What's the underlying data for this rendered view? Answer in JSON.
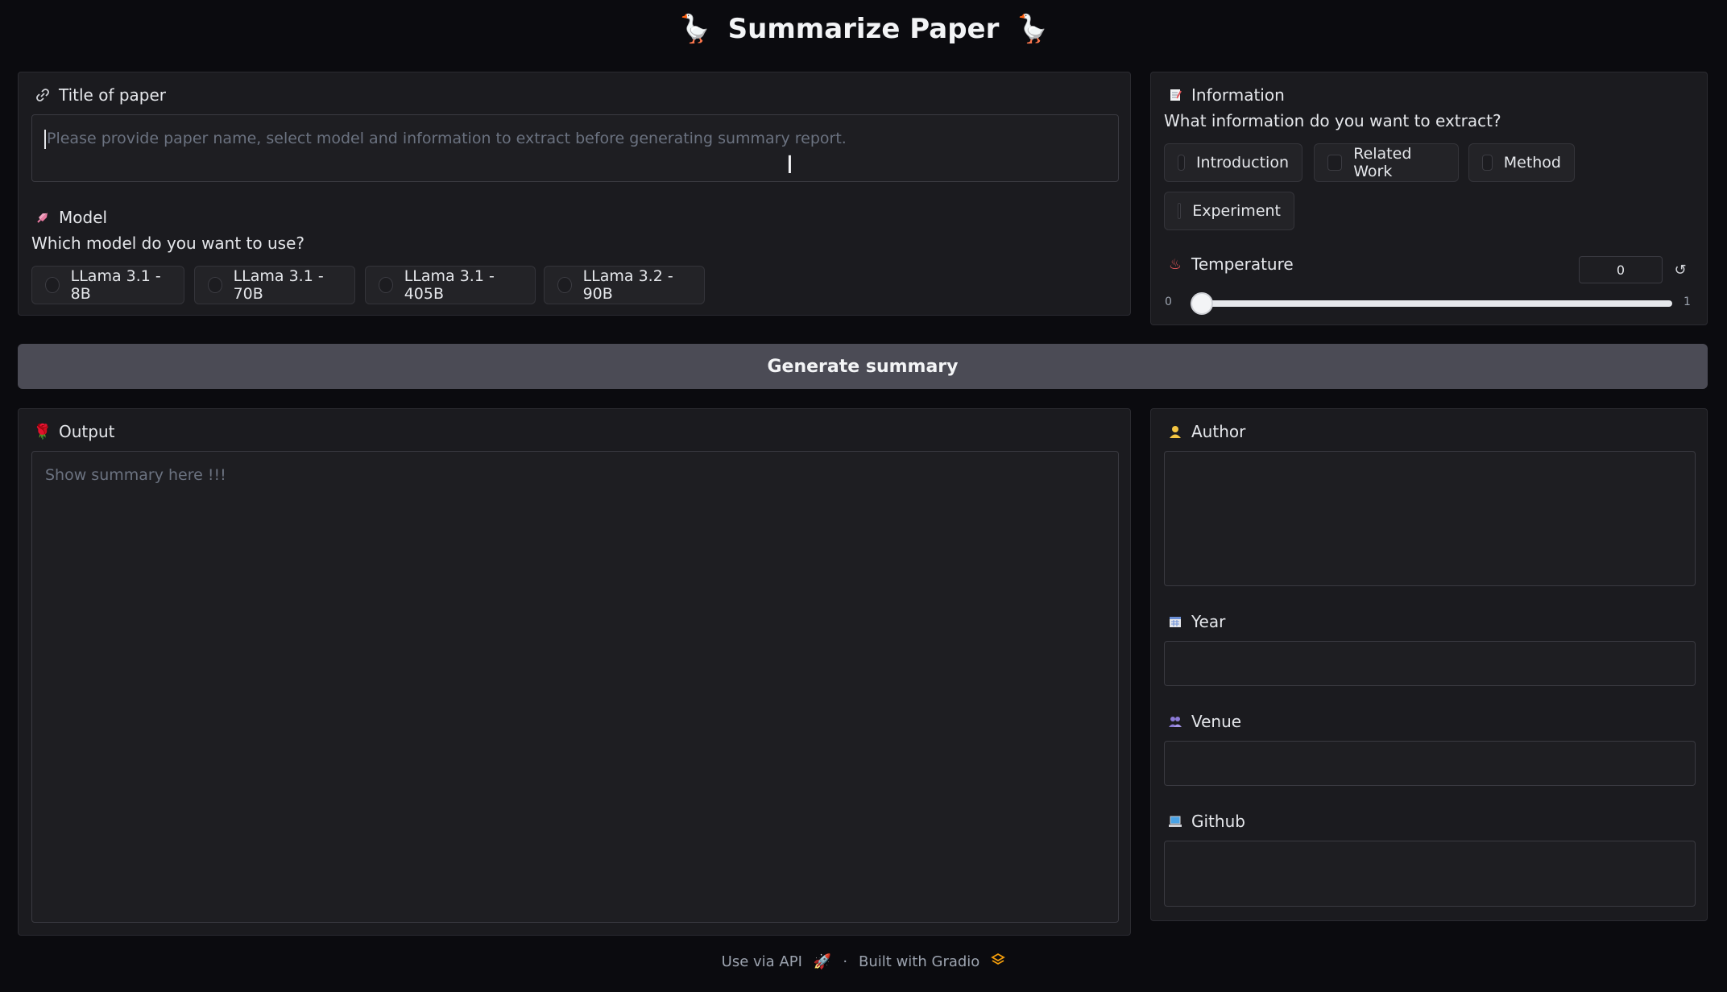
{
  "header": {
    "title": "Summarize Paper",
    "left_icon": "🪿",
    "right_icon": "🪿"
  },
  "paper": {
    "label": "Title of paper",
    "label_icon": "link-icon",
    "placeholder": "Please provide paper name, select model and information to extract before generating summary report.",
    "value": ""
  },
  "model": {
    "label": "Model",
    "label_icon": "rocket-icon",
    "question": "Which model do you want to use?",
    "options": [
      "LLama 3.1 - 8B",
      "LLama 3.1 - 70B",
      "LLama 3.1 - 405B",
      "LLama 3.2 - 90B"
    ],
    "selected": null
  },
  "information": {
    "label": "Information",
    "label_icon": "memo-icon",
    "question": "What information do you want to extract?",
    "options": [
      "Introduction",
      "Related Work",
      "Method",
      "Experiment"
    ],
    "checked": []
  },
  "temperature": {
    "label": "Temperature",
    "label_icon": "hot-springs-icon",
    "value": "0",
    "min": "0",
    "max": "1",
    "level": 0
  },
  "generate_button": "Generate summary",
  "output": {
    "label": "Output",
    "label_icon": "rose-icon",
    "placeholder": "Show summary here !!!",
    "value": ""
  },
  "fields": {
    "author": {
      "label": "Author",
      "icon": "person-icon",
      "value": ""
    },
    "year": {
      "label": "Year",
      "icon": "calendar-icon",
      "value": ""
    },
    "venue": {
      "label": "Venue",
      "icon": "people-icon",
      "value": ""
    },
    "github": {
      "label": "Github",
      "icon": "laptop-icon",
      "value": ""
    }
  },
  "footer": {
    "api_link": "Use via API",
    "separator": "·",
    "built_with": "Built with Gradio"
  },
  "colors": {
    "background": "#0b0b0f",
    "panel": "#1b1b1f",
    "button": "#4b4b55",
    "text": "#e5e7eb"
  }
}
